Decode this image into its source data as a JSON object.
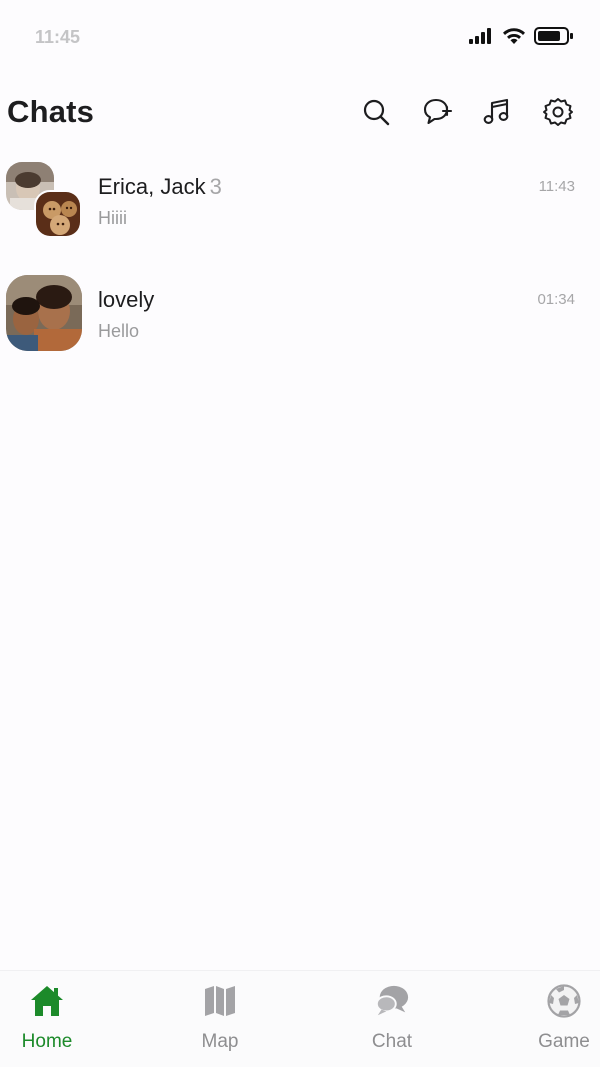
{
  "status_bar": {
    "time": "11:45",
    "icons": [
      "signal-icon",
      "wifi-icon",
      "battery-icon"
    ]
  },
  "header": {
    "title": "Chats",
    "actions": [
      {
        "name": "search-icon"
      },
      {
        "name": "new-chat-icon"
      },
      {
        "name": "music-icon"
      },
      {
        "name": "settings-icon"
      }
    ]
  },
  "chats": [
    {
      "name": "Erica, Jack",
      "count": "3",
      "preview": "Hiiii",
      "time": "11:43",
      "avatar": "group-avatar"
    },
    {
      "name": "lovely",
      "count": "",
      "preview": "Hello",
      "time": "01:34",
      "avatar": "photo-avatar"
    }
  ],
  "tabs": [
    {
      "label": "Home",
      "icon": "home-icon",
      "active": true
    },
    {
      "label": "Map",
      "icon": "map-icon",
      "active": false
    },
    {
      "label": "Chat",
      "icon": "chat-bubbles-icon",
      "active": false
    },
    {
      "label": "Game",
      "icon": "soccer-ball-icon",
      "active": false
    }
  ],
  "colors": {
    "accent": "#1c8a2a",
    "inactive": "#8e8e90",
    "background": "#fdfcfe"
  }
}
